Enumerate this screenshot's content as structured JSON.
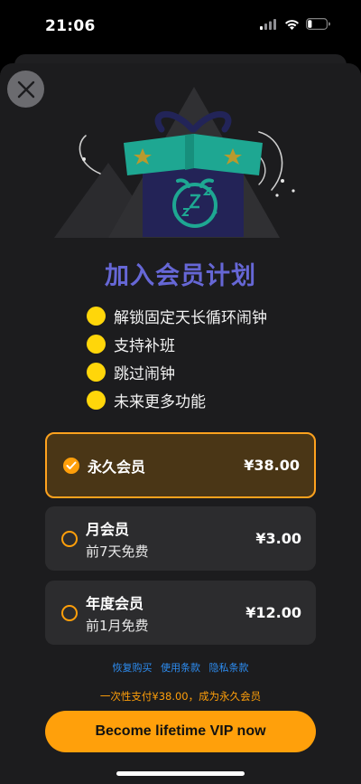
{
  "status_bar": {
    "time": "21:06"
  },
  "title": "加入会员计划",
  "features": [
    {
      "label": "解锁固定天长循环闹钟"
    },
    {
      "label": "支持补班"
    },
    {
      "label": "跳过闹钟"
    },
    {
      "label": "未来更多功能"
    }
  ],
  "plans": [
    {
      "name": "永久会员",
      "subtitle": "",
      "price": "¥38.00",
      "selected": true
    },
    {
      "name": "月会员",
      "subtitle": "前7天免费",
      "price": "¥3.00",
      "selected": false
    },
    {
      "name": "年度会员",
      "subtitle": "前1月免费",
      "price": "¥12.00",
      "selected": false
    }
  ],
  "links": {
    "restore": "恢复购买",
    "terms": "使用条款",
    "privacy": "隐私条款"
  },
  "note": "一次性支付¥38.00，成为永久会员",
  "cta": {
    "label": "Become lifetime VIP now"
  },
  "colors": {
    "accent": "#ff9f0a",
    "title": "#6667d6",
    "feature_dot": "#ffd60a",
    "gift_box": "#232357",
    "gift_lid": "#1ea792"
  },
  "icons": {
    "close": "close-icon",
    "check": "check-icon",
    "cellular": "cellular-signal-icon",
    "wifi": "wifi-icon",
    "battery": "battery-icon",
    "hero": "gift-alarm-clock-illustration"
  }
}
